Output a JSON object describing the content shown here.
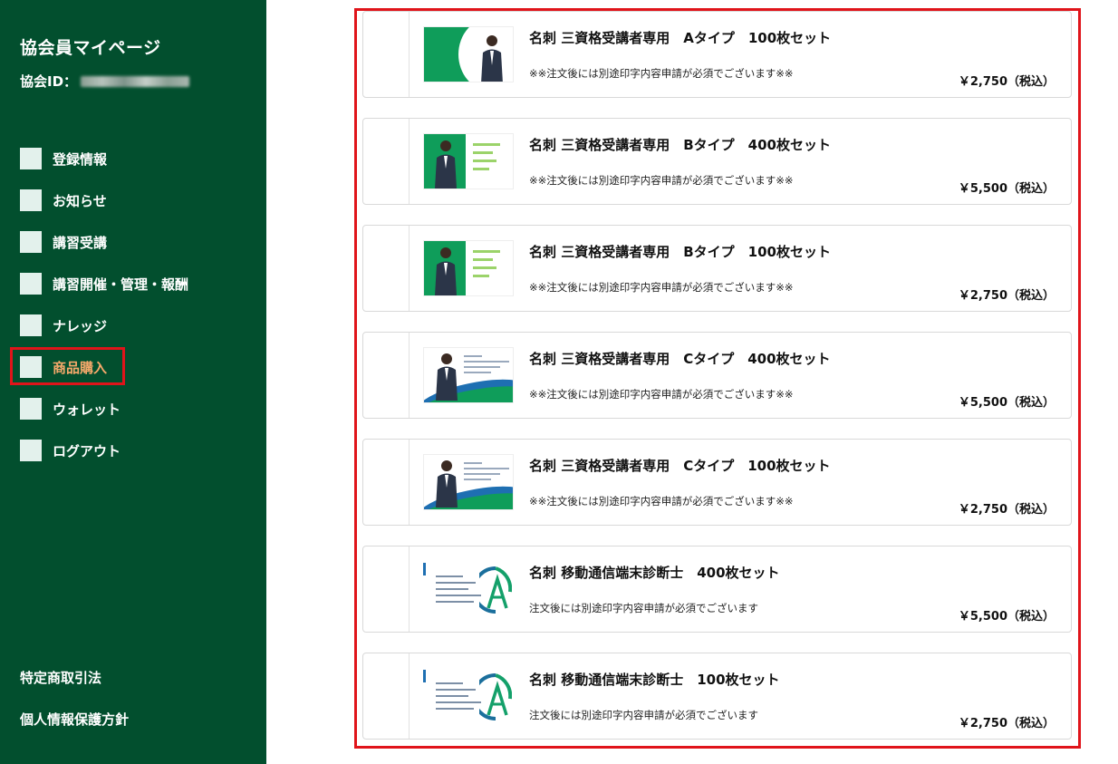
{
  "sidebar": {
    "title": "協会員マイページ",
    "member_id_label": "協会ID：",
    "nav": [
      {
        "label": "登録情報"
      },
      {
        "label": "お知らせ"
      },
      {
        "label": "講習受講"
      },
      {
        "label": "講習開催・管理・報酬"
      },
      {
        "label": "ナレッジ"
      },
      {
        "label": "商品購入",
        "active": true
      },
      {
        "label": "ウォレット"
      },
      {
        "label": "ログアウト"
      }
    ],
    "footer_links": [
      {
        "label": "特定商取引法"
      },
      {
        "label": "個人情報保護方針"
      }
    ]
  },
  "products": [
    {
      "name": "名刺 三資格受講者専用　Aタイプ　100枚セット",
      "note": "※※注文後には別途印字内容申請が必須でございます※※",
      "price": "￥2,750（税込）",
      "thumb": "type-a"
    },
    {
      "name": "名刺 三資格受講者専用　Bタイプ　400枚セット",
      "note": "※※注文後には別途印字内容申請が必須でございます※※",
      "price": "￥5,500（税込）",
      "thumb": "type-b"
    },
    {
      "name": "名刺 三資格受講者専用　Bタイプ　100枚セット",
      "note": "※※注文後には別途印字内容申請が必須でございます※※",
      "price": "￥2,750（税込）",
      "thumb": "type-b"
    },
    {
      "name": "名刺 三資格受講者専用　Cタイプ　400枚セット",
      "note": "※※注文後には別途印字内容申請が必須でございます※※",
      "price": "￥5,500（税込）",
      "thumb": "type-c"
    },
    {
      "name": "名刺 三資格受講者専用　Cタイプ　100枚セット",
      "note": "※※注文後には別途印字内容申請が必須でございます※※",
      "price": "￥2,750（税込）",
      "thumb": "type-c"
    },
    {
      "name": "名刺 移動通信端末診断士　400枚セット",
      "note": "注文後には別途印字内容申請が必須でございます",
      "price": "￥5,500（税込）",
      "thumb": "type-d"
    },
    {
      "name": "名刺 移動通信端末診断士　100枚セット",
      "note": "注文後には別途印字内容申請が必須でございます",
      "price": "￥2,750（税込）",
      "thumb": "type-d"
    }
  ],
  "colors": {
    "sidebar_bg": "#024f2e",
    "active_nav_text": "#f7a96b",
    "highlight_border": "#e0141a",
    "nav_box": "#e3f1ec"
  }
}
